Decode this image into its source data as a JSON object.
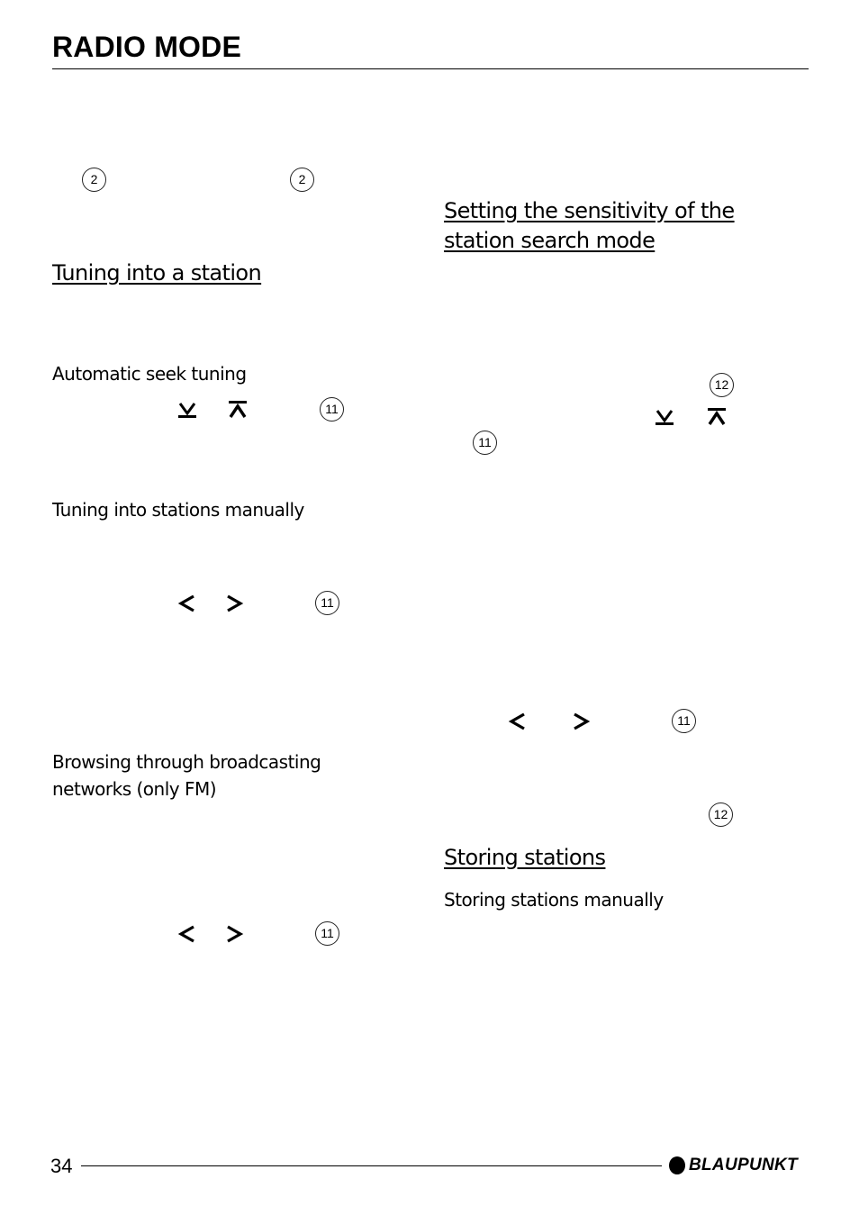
{
  "header": {
    "title": "RADIO MODE"
  },
  "left_column": {
    "callouts_top": [
      "2",
      "2"
    ],
    "section_tuning": {
      "heading": "Tuning into a station"
    },
    "automatic_seek": {
      "heading": "Automatic seek tuning",
      "icons": [
        "seek-down-icon",
        "seek-up-icon"
      ],
      "callout": "11"
    },
    "manual_tuning": {
      "heading": "Tuning into stations manually",
      "icons": [
        "arrow-left-icon",
        "arrow-right-icon"
      ],
      "callout": "11"
    },
    "browsing": {
      "heading_line1": "Browsing through broadcasting",
      "heading_line2": "networks (only FM)",
      "icons": [
        "arrow-left-icon",
        "arrow-right-icon"
      ],
      "callout": "11"
    }
  },
  "right_column": {
    "sensitivity": {
      "heading_line1": "Setting the sensitivity of the",
      "heading_line2": "station search mode",
      "callout_a": "12",
      "icons": [
        "seek-down-icon",
        "seek-up-icon"
      ],
      "callout_b": "11",
      "arrows_callout": "11",
      "callout_c": "12"
    },
    "storing": {
      "heading": "Storing stations",
      "subheading": "Storing stations manually"
    }
  },
  "footer": {
    "page_number": "34",
    "brand": "BLAUPUNKT"
  }
}
